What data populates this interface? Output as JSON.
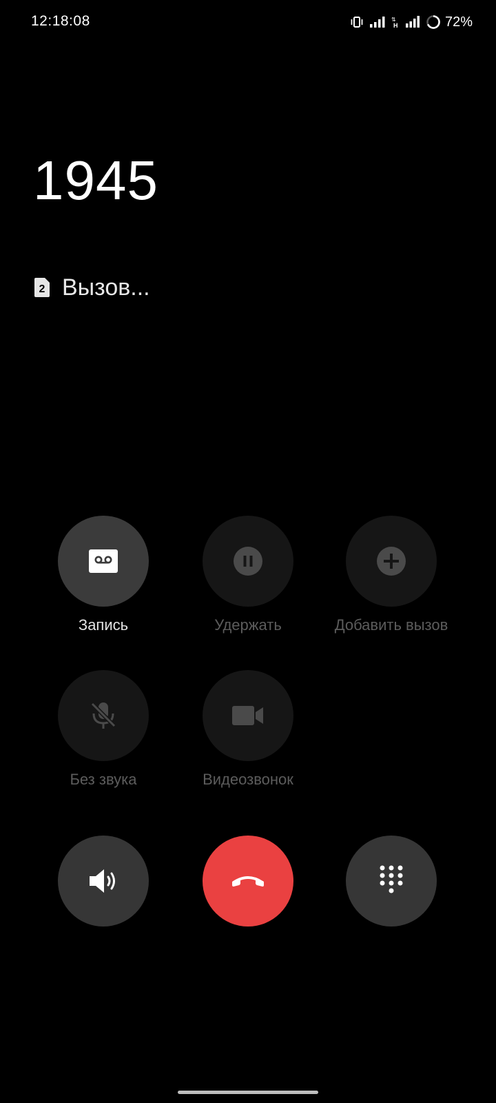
{
  "status_bar": {
    "time": "12:18:08",
    "battery_percent": "72%",
    "icons": [
      "vibrate-icon",
      "signal-1-icon",
      "hplus-data-icon",
      "signal-2-icon",
      "battery-icon"
    ]
  },
  "call": {
    "number": "1945",
    "sim_slot": "2",
    "status": "Вызов..."
  },
  "controls": {
    "record": {
      "label": "Запись",
      "icon": "cassette-icon",
      "enabled": true
    },
    "hold": {
      "label": "Удержать",
      "icon": "pause-icon",
      "enabled": false
    },
    "add_call": {
      "label": "Добавить вызов",
      "icon": "plus-icon",
      "enabled": false
    },
    "mute": {
      "label": "Без звука",
      "icon": "mic-off-icon",
      "enabled": false
    },
    "video_call": {
      "label": "Видеозвонок",
      "icon": "video-camera-icon",
      "enabled": false
    }
  },
  "bottom_actions": {
    "speaker": {
      "icon": "speaker-icon"
    },
    "end_call": {
      "icon": "phone-hangup-icon"
    },
    "keypad": {
      "icon": "dialpad-icon"
    }
  },
  "colors": {
    "background": "#000000",
    "end_call": "#ea4141",
    "active_button": "#3b3b3b",
    "disabled_button": "#161616"
  }
}
